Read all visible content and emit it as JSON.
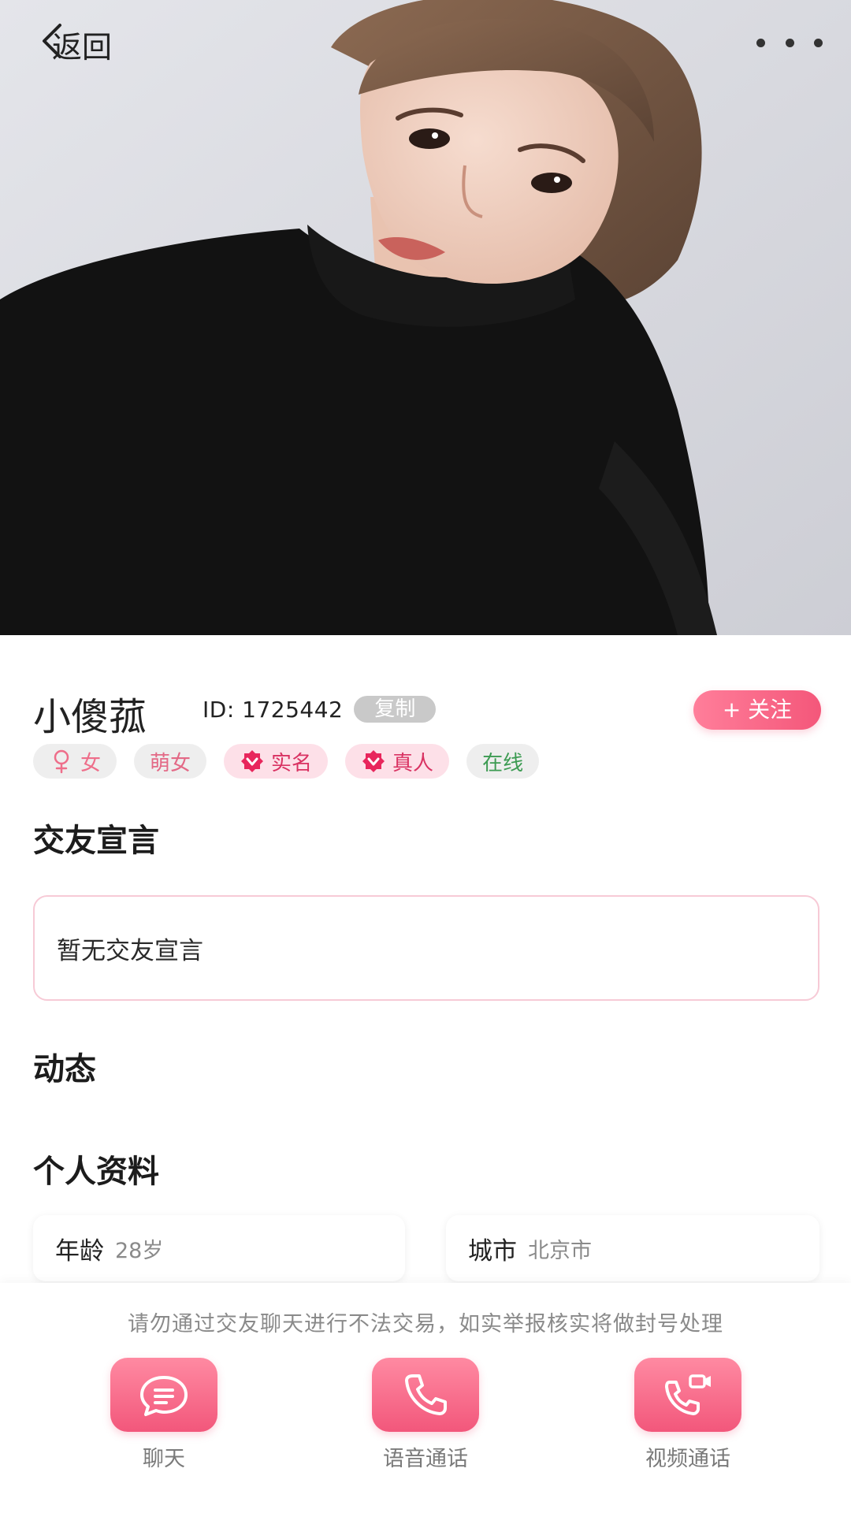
{
  "topbar": {
    "back_label": "返回",
    "back_icon": "chevron-left-icon",
    "more_icon": "more-horizontal-icon"
  },
  "hero": {
    "photo": "profile-photo"
  },
  "profile": {
    "nickname": "小傻菰",
    "id_text": "ID:  1725442",
    "copy_label": "复制",
    "follow_label": "+ 关注",
    "tags": {
      "gender": "女",
      "gender_icon": "female-icon",
      "cute": "萌女",
      "real_name": "实名",
      "real_person": "真人",
      "verify_icon": "verified-badge-icon",
      "online": "在线"
    },
    "accent_color": "#f4577a"
  },
  "manifesto": {
    "title": "交友宣言",
    "text": "暂无交友宣言"
  },
  "moments": {
    "title": "动态"
  },
  "personal_info": {
    "title": "个人资料",
    "age_label": "年龄",
    "age_value": "28岁",
    "city_label": "城市",
    "city_value": "北京市"
  },
  "bottom": {
    "notice": "请勿通过交友聊天进行不法交易，如实举报核实将做封号处理",
    "chat_label": "聊天",
    "voice_label": "语音通话",
    "video_label": "视频通话",
    "chat_icon": "chat-bubble-icon",
    "voice_icon": "phone-icon",
    "video_icon": "video-call-icon"
  }
}
